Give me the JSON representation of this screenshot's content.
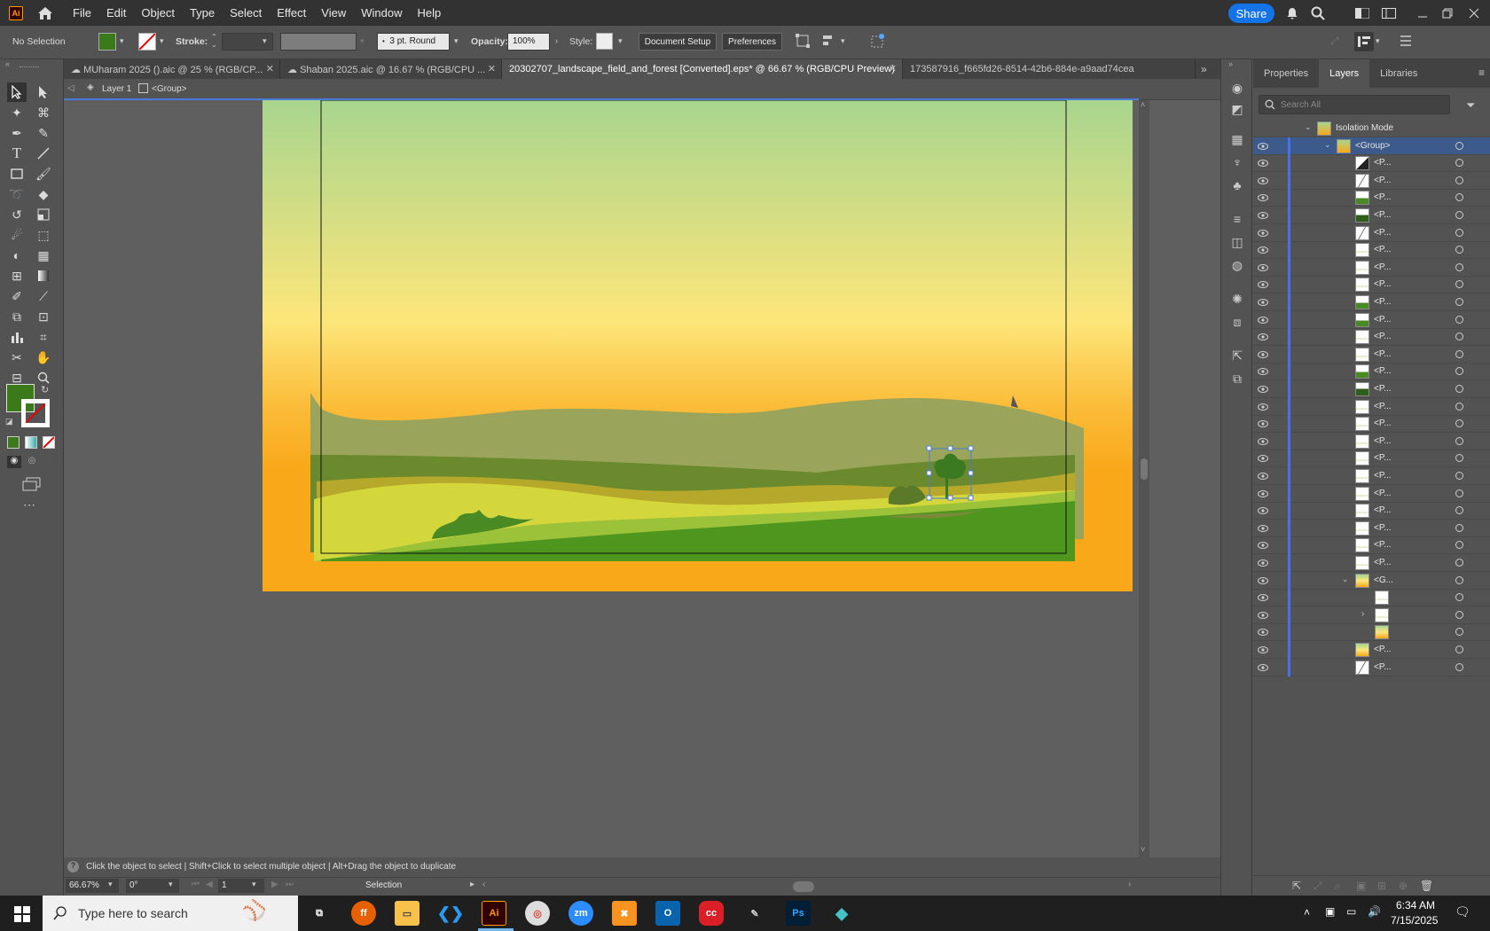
{
  "app": {
    "logo": "Ai"
  },
  "menu": [
    "File",
    "Edit",
    "Object",
    "Type",
    "Select",
    "Effect",
    "View",
    "Window",
    "Help"
  ],
  "header": {
    "share": "Share"
  },
  "control": {
    "selection": "No Selection",
    "stroke_label": "Stroke:",
    "brush": "3 pt. Round",
    "opacity_label": "Opacity:",
    "opacity": "100%",
    "style_label": "Style:",
    "doc_setup": "Document Setup",
    "preferences": "Preferences",
    "fill_color": "#3b7a1a"
  },
  "tabs": [
    {
      "label": "MUharam 2025 ().aic @ 25 % (RGB/CP..."
    },
    {
      "label": "Shaban 2025.aic @ 16.67 % (RGB/CPU ..."
    },
    {
      "label": "20302707_landscape_field_and_forest [Converted].eps* @ 66.67 % (RGB/CPU Preview)"
    },
    {
      "label": "173587916_f665fd26-8514-42b6-884e-a9aad74cea"
    }
  ],
  "breadcrumb": {
    "layer": "Layer 1",
    "group": "<Group>"
  },
  "panel": {
    "tabs": [
      "Properties",
      "Layers",
      "Libraries"
    ],
    "search_placeholder": "Search All",
    "isolation": "Isolation Mode",
    "group": "<Group>",
    "item": "<P...",
    "subgroup": "<G..."
  },
  "status": {
    "hint": "Click the object to select  |  Shift+Click to select multiple object  |  Alt+Drag the object to duplicate",
    "zoom": "66.67%",
    "rotation": "0°",
    "artboard": "1",
    "tool": "Selection"
  },
  "taskbar": {
    "search": "Type here to search",
    "time": "6:34 AM",
    "date": "7/15/2025"
  },
  "colors": {
    "sky_top": "#a8d58e",
    "sky_mid": "#fde67a",
    "sky_bottom": "#f9a81a",
    "accent": "#1473e6"
  }
}
